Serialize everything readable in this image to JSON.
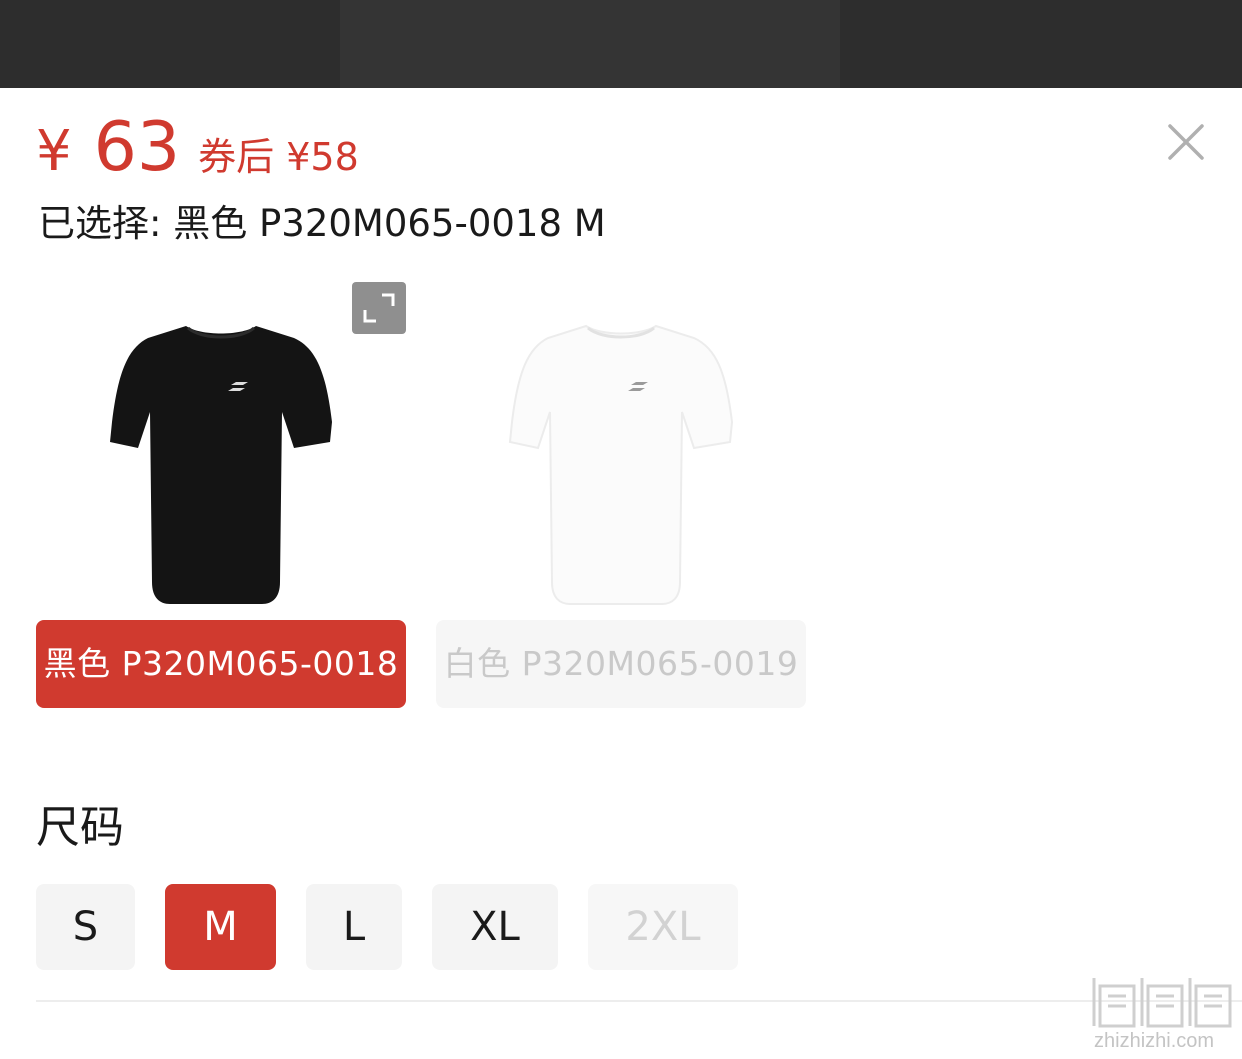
{
  "price": {
    "symbol": "¥",
    "amount": "63",
    "coupon_price": "券后 ¥58"
  },
  "selected": {
    "text": "已选择: 黑色 P320M065-0018 M"
  },
  "colors": [
    {
      "label": "黑色 P320M065-0018",
      "selected": true,
      "available": true
    },
    {
      "label": "白色 P320M065-0019",
      "selected": false,
      "available": false
    }
  ],
  "size_section": {
    "title": "尺码",
    "options": [
      {
        "label": "S",
        "state": "available"
      },
      {
        "label": "M",
        "state": "selected"
      },
      {
        "label": "L",
        "state": "available"
      },
      {
        "label": "XL",
        "state": "available"
      },
      {
        "label": "2XL",
        "state": "disabled"
      }
    ]
  },
  "watermark": {
    "site": "zhizhizhi.com"
  },
  "colors_palette": {
    "accent": "#d03a2f",
    "option_bg": "#f4f4f4",
    "disabled_text": "#d2d2d2"
  },
  "icons": [
    "close-icon",
    "expand-icon"
  ]
}
